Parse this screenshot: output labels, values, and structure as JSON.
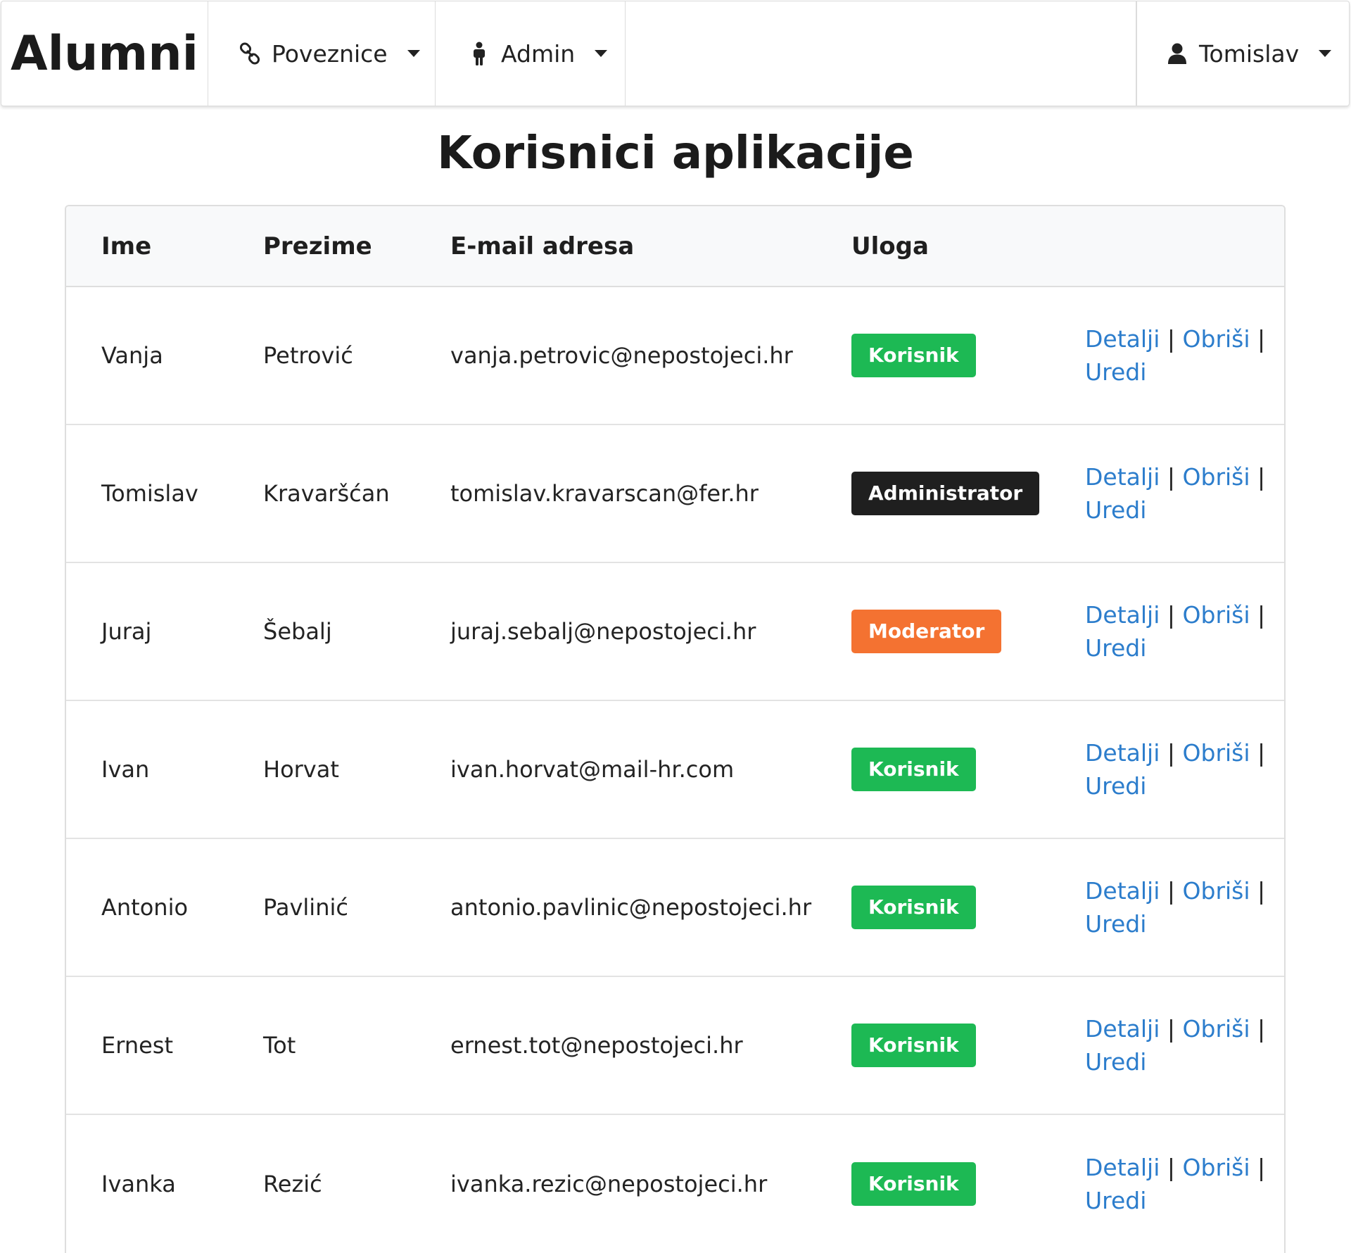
{
  "nav": {
    "brand": "Alumni",
    "links_label": "Poveznice",
    "admin_label": "Admin",
    "user_label": "Tomislav"
  },
  "page": {
    "title": "Korisnici aplikacije"
  },
  "table": {
    "headers": {
      "first_name": "Ime",
      "last_name": "Prezime",
      "email": "E-mail adresa",
      "role": "Uloga"
    },
    "action_labels": {
      "details": "Detalji",
      "delete": "Obriši",
      "edit": "Uredi",
      "separator": "|"
    },
    "rows": [
      {
        "first_name": "Vanja",
        "last_name": "Petrović",
        "email": "vanja.petrovic@nepostojeci.hr",
        "role": "Korisnik",
        "role_color": "#1db954"
      },
      {
        "first_name": "Tomislav",
        "last_name": "Kravaršćan",
        "email": "tomislav.kravarscan@fer.hr",
        "role": "Administrator",
        "role_color": "#1f1f1f"
      },
      {
        "first_name": "Juraj",
        "last_name": "Šebalj",
        "email": "juraj.sebalj@nepostojeci.hr",
        "role": "Moderator",
        "role_color": "#f47231"
      },
      {
        "first_name": "Ivan",
        "last_name": "Horvat",
        "email": "ivan.horvat@mail-hr.com",
        "role": "Korisnik",
        "role_color": "#1db954"
      },
      {
        "first_name": "Antonio",
        "last_name": "Pavlinić",
        "email": "antonio.pavlinic@nepostojeci.hr",
        "role": "Korisnik",
        "role_color": "#1db954"
      },
      {
        "first_name": "Ernest",
        "last_name": "Tot",
        "email": "ernest.tot@nepostojeci.hr",
        "role": "Korisnik",
        "role_color": "#1db954"
      },
      {
        "first_name": "Ivanka",
        "last_name": "Rezić",
        "email": "ivanka.rezic@nepostojeci.hr",
        "role": "Korisnik",
        "role_color": "#1db954"
      }
    ]
  },
  "colors": {
    "link": "#2c7dcc",
    "header_bg": "#f8f9fa"
  },
  "icons": {
    "links": "link-icon",
    "admin": "person-standing-icon",
    "user": "user-icon",
    "dropdown": "caret-down-icon"
  }
}
